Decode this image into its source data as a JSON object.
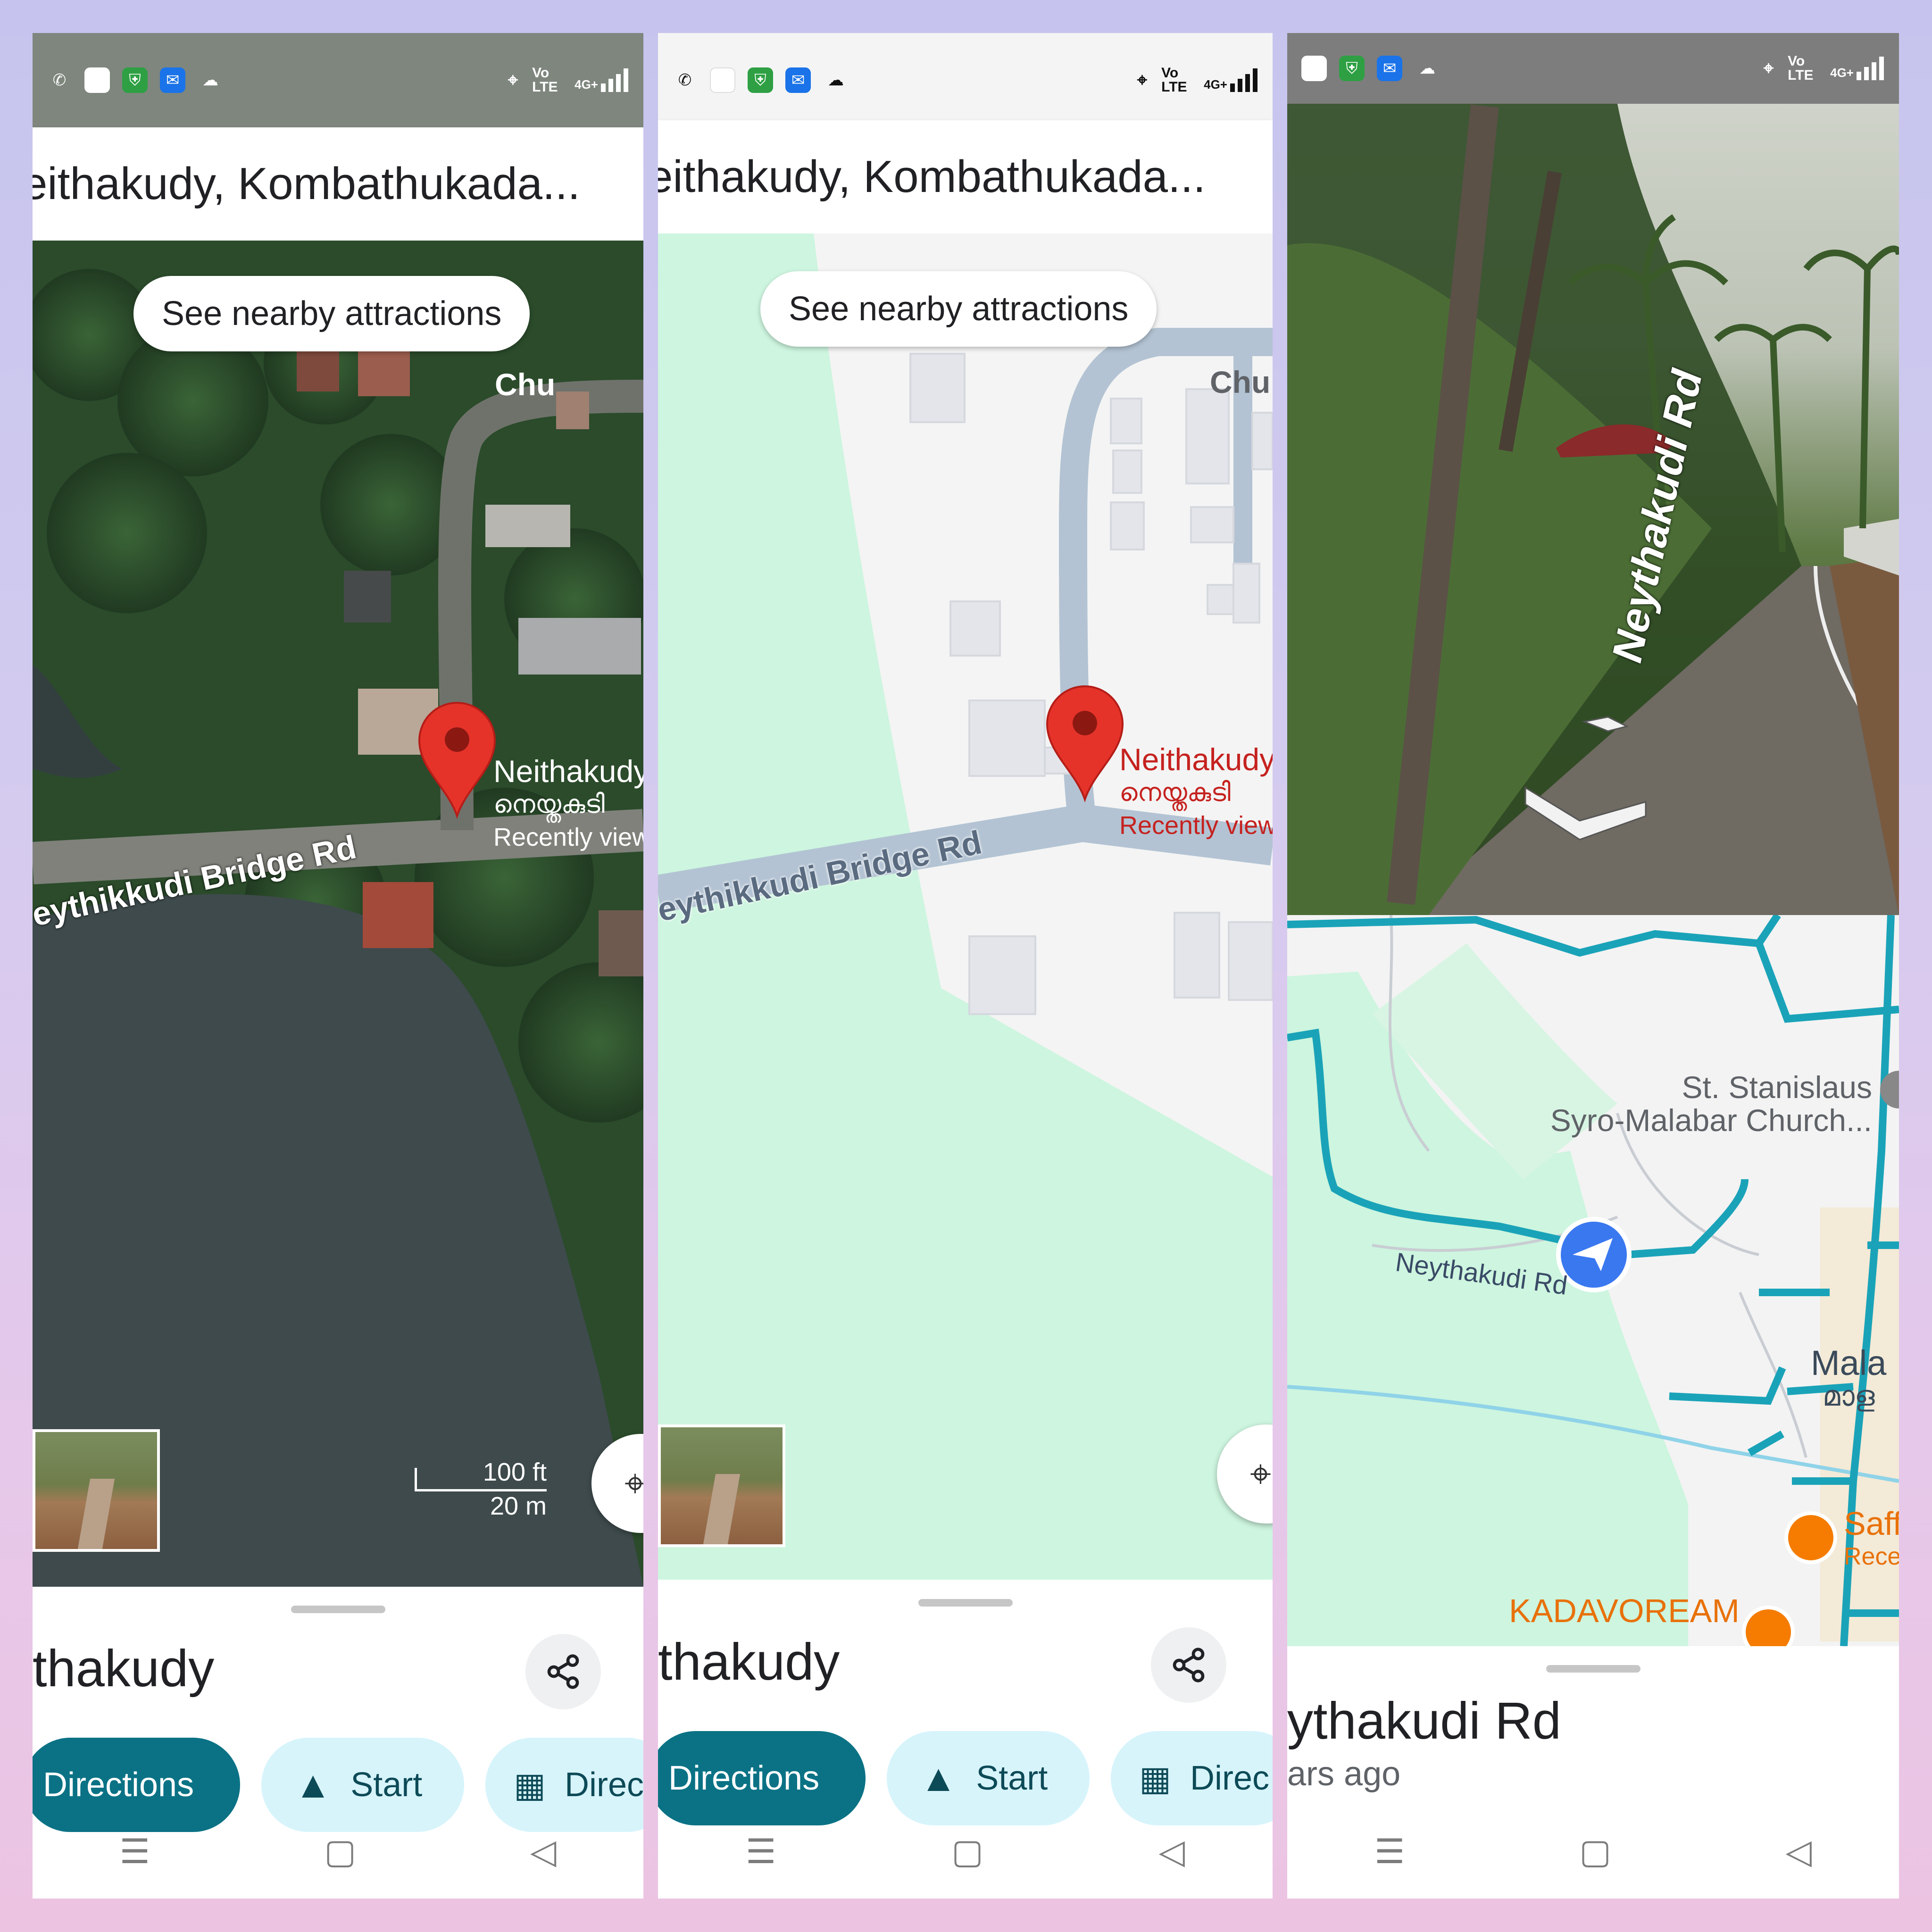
{
  "status_bar": {
    "left_icons": [
      "whatsapp-icon",
      "app-icon",
      "shield-icon",
      "message-icon",
      "cloud-icon"
    ],
    "right_icons": [
      "location-icon",
      "volte-icon",
      "signal-icon"
    ],
    "volte": "Vo LTE",
    "network": "4G+"
  },
  "screens": [
    {
      "search_text": "eithakudy, Kombathukada...",
      "nearby_button": "See nearby attractions",
      "map_labels": {
        "chu": "Chu",
        "place_name": "Neithakudy",
        "place_name_ml": "നെയ്തകുടി",
        "recently_viewed": "Recently view",
        "road": "eythikkudi Bridge Rd"
      },
      "scale": {
        "ft": "100 ft",
        "m": "20 m"
      },
      "sheet": {
        "title": "thakudy",
        "directions": "Directions",
        "start": "Start",
        "direct_partial": "Direc"
      }
    },
    {
      "search_text": "eithakudy, Kombathukada...",
      "nearby_button": "See nearby attractions",
      "map_labels": {
        "chu": "Chu",
        "place_name": "Neithakudy",
        "place_name_ml": "നെയ്തകുടി",
        "recently_viewed": "Recently view",
        "road": "eythikkudi Bridge Rd"
      },
      "sheet": {
        "title": "thakudy",
        "directions": "Directions",
        "start": "Start",
        "direct_partial": "Direc"
      }
    },
    {
      "street_view_road_label": "Neythakudi Rd",
      "map_labels": {
        "church_line1": "St. Stanislaus",
        "church_line2": "Syro-Malabar Church...",
        "road": "Neythakudi Rd",
        "town": "Mala",
        "town_ml": "മാള",
        "restaurant1_line1": "Saff",
        "restaurant1_line2": "Rece",
        "restaurant2": "KADAVOREAM"
      },
      "sheet": {
        "title": "ythakudi Rd",
        "subtitle": "ars ago"
      }
    }
  ],
  "colors": {
    "primary_button": "#0b7285",
    "secondary_button": "#d7f4fb",
    "pin": "#e5332a",
    "route": "#1aa3b8",
    "nav_arrow": "#3a78f0",
    "restaurant": "#f57c00"
  }
}
